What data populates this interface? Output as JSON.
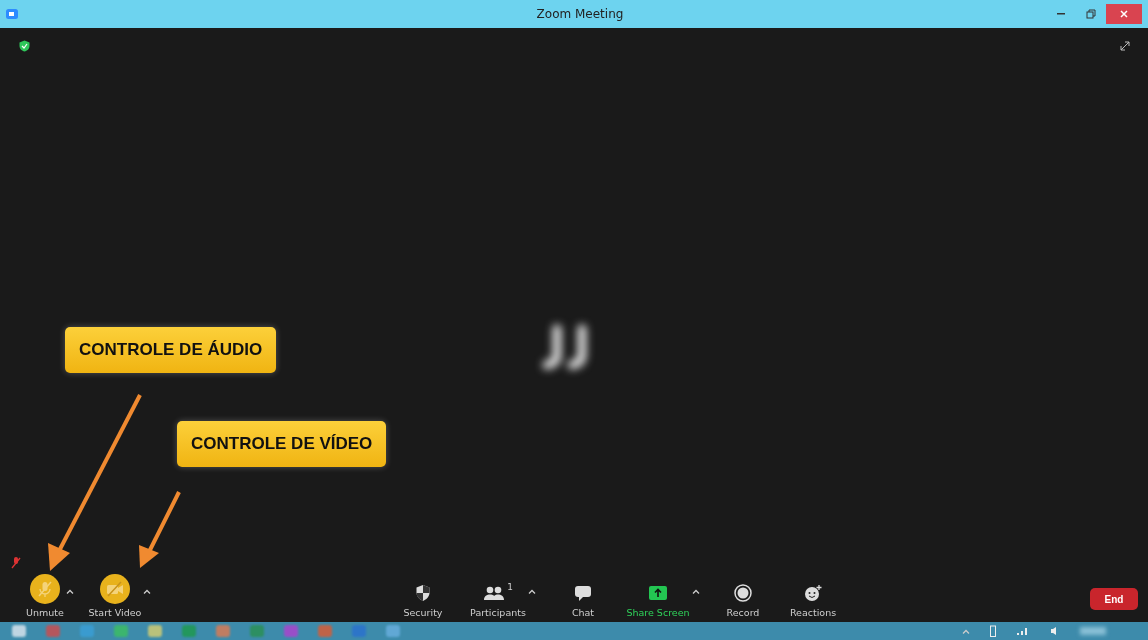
{
  "window": {
    "title": "Zoom Meeting"
  },
  "callouts": [
    {
      "text": "CONTROLE DE ÁUDIO"
    },
    {
      "text": "CONTROLE DE VÍDEO"
    }
  ],
  "toolbar": {
    "left": [
      {
        "kind": "mic",
        "label": "Unmute",
        "muted": true,
        "highlighted": true,
        "has_menu": true
      },
      {
        "kind": "video",
        "label": "Start Video",
        "muted": true,
        "highlighted": true,
        "has_menu": true
      }
    ],
    "center": [
      {
        "kind": "security",
        "label": "Security"
      },
      {
        "kind": "participants",
        "label": "Participants",
        "count": "1",
        "has_menu": true
      },
      {
        "kind": "chat",
        "label": "Chat"
      },
      {
        "kind": "share",
        "label": "Share Screen",
        "has_menu": true
      },
      {
        "kind": "record",
        "label": "Record"
      },
      {
        "kind": "reactions",
        "label": "Reactions"
      }
    ],
    "end_button": "End"
  }
}
